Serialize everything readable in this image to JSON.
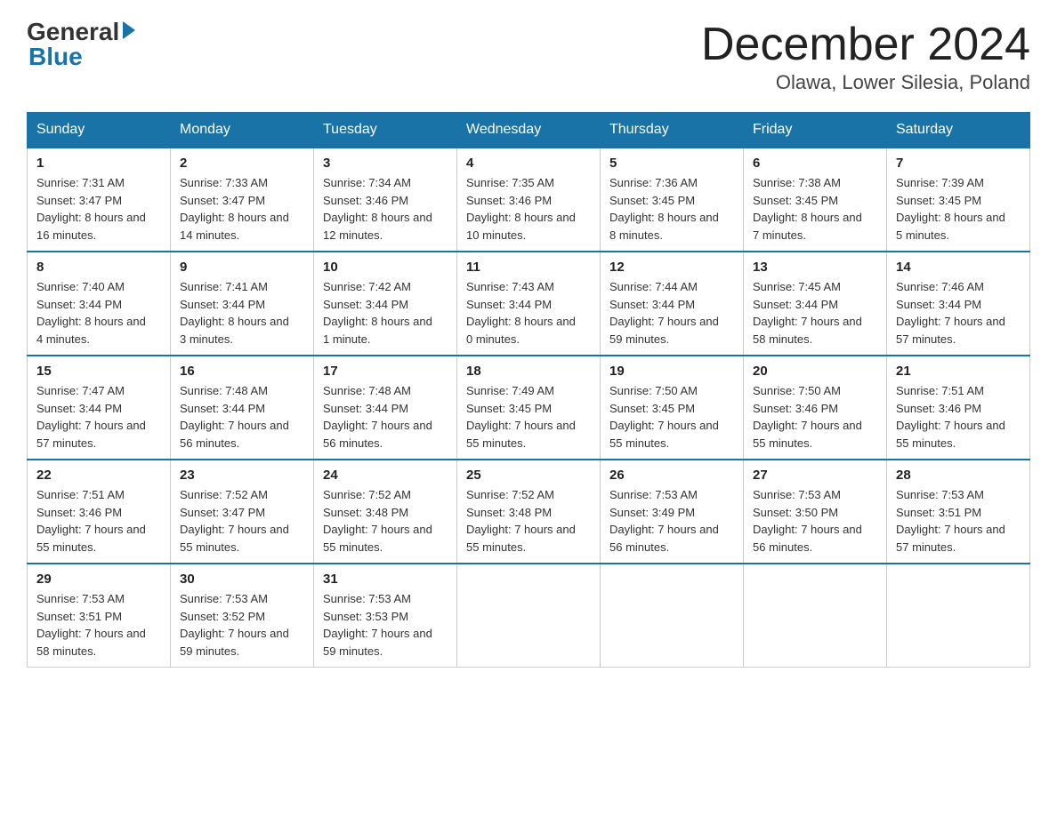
{
  "logo": {
    "general": "General",
    "blue": "Blue"
  },
  "title": "December 2024",
  "subtitle": "Olawa, Lower Silesia, Poland",
  "days_of_week": [
    "Sunday",
    "Monday",
    "Tuesday",
    "Wednesday",
    "Thursday",
    "Friday",
    "Saturday"
  ],
  "weeks": [
    [
      {
        "day": 1,
        "sunrise": "7:31 AM",
        "sunset": "3:47 PM",
        "daylight": "8 hours and 16 minutes."
      },
      {
        "day": 2,
        "sunrise": "7:33 AM",
        "sunset": "3:47 PM",
        "daylight": "8 hours and 14 minutes."
      },
      {
        "day": 3,
        "sunrise": "7:34 AM",
        "sunset": "3:46 PM",
        "daylight": "8 hours and 12 minutes."
      },
      {
        "day": 4,
        "sunrise": "7:35 AM",
        "sunset": "3:46 PM",
        "daylight": "8 hours and 10 minutes."
      },
      {
        "day": 5,
        "sunrise": "7:36 AM",
        "sunset": "3:45 PM",
        "daylight": "8 hours and 8 minutes."
      },
      {
        "day": 6,
        "sunrise": "7:38 AM",
        "sunset": "3:45 PM",
        "daylight": "8 hours and 7 minutes."
      },
      {
        "day": 7,
        "sunrise": "7:39 AM",
        "sunset": "3:45 PM",
        "daylight": "8 hours and 5 minutes."
      }
    ],
    [
      {
        "day": 8,
        "sunrise": "7:40 AM",
        "sunset": "3:44 PM",
        "daylight": "8 hours and 4 minutes."
      },
      {
        "day": 9,
        "sunrise": "7:41 AM",
        "sunset": "3:44 PM",
        "daylight": "8 hours and 3 minutes."
      },
      {
        "day": 10,
        "sunrise": "7:42 AM",
        "sunset": "3:44 PM",
        "daylight": "8 hours and 1 minute."
      },
      {
        "day": 11,
        "sunrise": "7:43 AM",
        "sunset": "3:44 PM",
        "daylight": "8 hours and 0 minutes."
      },
      {
        "day": 12,
        "sunrise": "7:44 AM",
        "sunset": "3:44 PM",
        "daylight": "7 hours and 59 minutes."
      },
      {
        "day": 13,
        "sunrise": "7:45 AM",
        "sunset": "3:44 PM",
        "daylight": "7 hours and 58 minutes."
      },
      {
        "day": 14,
        "sunrise": "7:46 AM",
        "sunset": "3:44 PM",
        "daylight": "7 hours and 57 minutes."
      }
    ],
    [
      {
        "day": 15,
        "sunrise": "7:47 AM",
        "sunset": "3:44 PM",
        "daylight": "7 hours and 57 minutes."
      },
      {
        "day": 16,
        "sunrise": "7:48 AM",
        "sunset": "3:44 PM",
        "daylight": "7 hours and 56 minutes."
      },
      {
        "day": 17,
        "sunrise": "7:48 AM",
        "sunset": "3:44 PM",
        "daylight": "7 hours and 56 minutes."
      },
      {
        "day": 18,
        "sunrise": "7:49 AM",
        "sunset": "3:45 PM",
        "daylight": "7 hours and 55 minutes."
      },
      {
        "day": 19,
        "sunrise": "7:50 AM",
        "sunset": "3:45 PM",
        "daylight": "7 hours and 55 minutes."
      },
      {
        "day": 20,
        "sunrise": "7:50 AM",
        "sunset": "3:46 PM",
        "daylight": "7 hours and 55 minutes."
      },
      {
        "day": 21,
        "sunrise": "7:51 AM",
        "sunset": "3:46 PM",
        "daylight": "7 hours and 55 minutes."
      }
    ],
    [
      {
        "day": 22,
        "sunrise": "7:51 AM",
        "sunset": "3:46 PM",
        "daylight": "7 hours and 55 minutes."
      },
      {
        "day": 23,
        "sunrise": "7:52 AM",
        "sunset": "3:47 PM",
        "daylight": "7 hours and 55 minutes."
      },
      {
        "day": 24,
        "sunrise": "7:52 AM",
        "sunset": "3:48 PM",
        "daylight": "7 hours and 55 minutes."
      },
      {
        "day": 25,
        "sunrise": "7:52 AM",
        "sunset": "3:48 PM",
        "daylight": "7 hours and 55 minutes."
      },
      {
        "day": 26,
        "sunrise": "7:53 AM",
        "sunset": "3:49 PM",
        "daylight": "7 hours and 56 minutes."
      },
      {
        "day": 27,
        "sunrise": "7:53 AM",
        "sunset": "3:50 PM",
        "daylight": "7 hours and 56 minutes."
      },
      {
        "day": 28,
        "sunrise": "7:53 AM",
        "sunset": "3:51 PM",
        "daylight": "7 hours and 57 minutes."
      }
    ],
    [
      {
        "day": 29,
        "sunrise": "7:53 AM",
        "sunset": "3:51 PM",
        "daylight": "7 hours and 58 minutes."
      },
      {
        "day": 30,
        "sunrise": "7:53 AM",
        "sunset": "3:52 PM",
        "daylight": "7 hours and 59 minutes."
      },
      {
        "day": 31,
        "sunrise": "7:53 AM",
        "sunset": "3:53 PM",
        "daylight": "7 hours and 59 minutes."
      },
      null,
      null,
      null,
      null
    ]
  ],
  "labels": {
    "sunrise": "Sunrise:",
    "sunset": "Sunset:",
    "daylight": "Daylight:"
  }
}
